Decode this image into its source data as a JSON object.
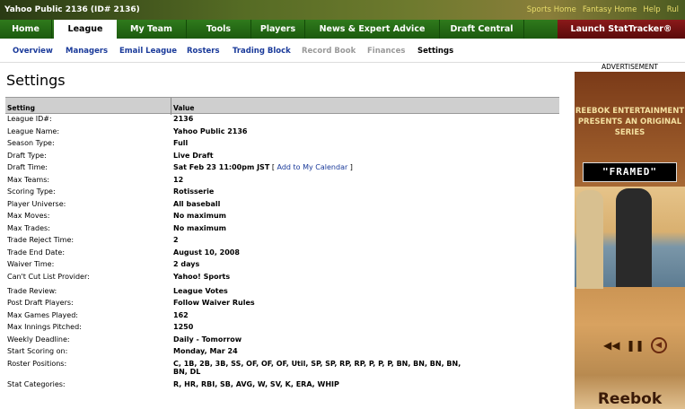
{
  "header": {
    "title": "Yahoo Public 2136 (ID# 2136)",
    "links": [
      "Sports Home",
      "Fantasy Home",
      "Help",
      "Rul"
    ]
  },
  "nav": {
    "tabs": [
      "Home",
      "League",
      "My Team",
      "Tools",
      "Players",
      "News & Expert Advice",
      "Draft Central"
    ],
    "active": "League",
    "launch": "Launch StatTracker®"
  },
  "subnav": {
    "items": [
      "Overview",
      "Managers",
      "Email League",
      "Rosters",
      "Trading Block",
      "Record Book",
      "Finances",
      "Settings"
    ]
  },
  "page_title": "Settings",
  "table": {
    "col_setting": "Setting",
    "col_value": "Value",
    "rows": [
      {
        "label": "League ID#:",
        "value": "2136"
      },
      {
        "label": "League Name:",
        "value": "Yahoo Public 2136"
      },
      {
        "label": "Season Type:",
        "value": "Full"
      },
      {
        "label": "Draft Type:",
        "value": "Live Draft"
      },
      {
        "label": "Draft Time:",
        "value": "Sat Feb 23 11:00pm JST",
        "link": "Add to My Calendar"
      },
      {
        "label": "Max Teams:",
        "value": "12"
      },
      {
        "label": "Scoring Type:",
        "value": "Rotisserie"
      },
      {
        "label": "Player Universe:",
        "value": "All baseball"
      },
      {
        "label": "Max Moves:",
        "value": "No maximum"
      },
      {
        "label": "Max Trades:",
        "value": "No maximum"
      },
      {
        "label": "Trade Reject Time:",
        "value": "2"
      },
      {
        "label": "Trade End Date:",
        "value": "August 10, 2008"
      },
      {
        "label": "Waiver Time:",
        "value": "2 days"
      },
      {
        "label": "Can't Cut List Provider:",
        "value": "Yahoo! Sports"
      },
      {
        "label": "Trade Review:",
        "value": "League Votes"
      },
      {
        "label": "Post Draft Players:",
        "value": "Follow Waiver Rules"
      },
      {
        "label": "Max Games Played:",
        "value": "162"
      },
      {
        "label": "Max Innings Pitched:",
        "value": "1250"
      },
      {
        "label": "Weekly Deadline:",
        "value": "Daily - Tomorrow"
      },
      {
        "label": "Start Scoring on:",
        "value": "Monday, Mar 24"
      },
      {
        "label": "Roster Positions:",
        "value": "C, 1B, 2B, 3B, SS, OF, OF, OF, Util, SP, SP, RP, RP, P, P, P, BN, BN, BN, BN, BN, DL"
      },
      {
        "label": "Stat Categories:",
        "value": "R, HR, RBI, SB, AVG, W, SV, K, ERA, WHIP"
      }
    ]
  },
  "ad": {
    "label": "ADVERTISEMENT",
    "headline": "REEBOK ENTERTAINMENT PRESENTS AN ORIGINAL SERIES",
    "show": "\"FRAMED\"",
    "brand": "Reebok"
  }
}
